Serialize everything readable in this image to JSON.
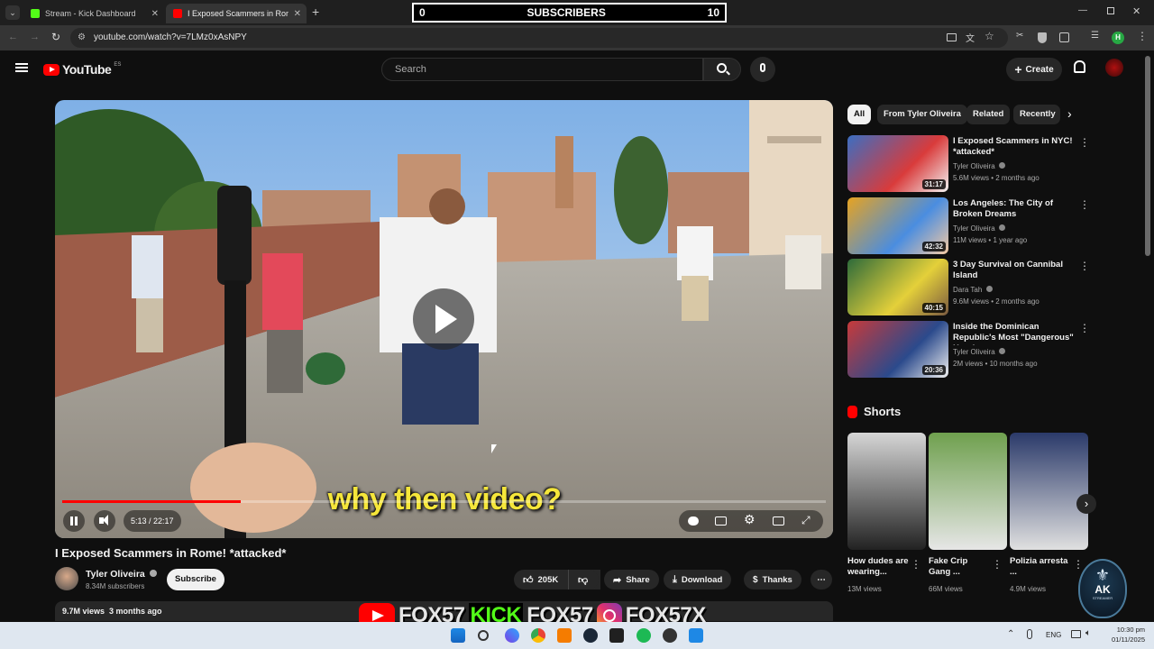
{
  "browser": {
    "tabs": [
      {
        "label": "Stream - Kick Dashboard"
      },
      {
        "label": "I Exposed Scammers in Rome! *att"
      }
    ],
    "url": "youtube.com/watch?v=7LMz0xAsNPY"
  },
  "overlay": {
    "sub_left": "0",
    "sub_label": "SUBSCRIBERS",
    "sub_right": "10",
    "caption": "why then video?",
    "banner": [
      "FOX57",
      "FOX57",
      "FOX57X"
    ],
    "kick_word": "KICK",
    "logo_text": "AK",
    "logo_sub": "STREAMER"
  },
  "header": {
    "brand": "YouTube",
    "region": "ES",
    "search_placeholder": "Search",
    "create_label": "Create"
  },
  "player": {
    "time": "5:13 / 22:17",
    "progress": 0.234
  },
  "video": {
    "title": "I Exposed Scammers in Rome! *attacked*",
    "channel": "Tyler Oliveira",
    "subscribers": "8.34M subscribers",
    "subscribe_label": "Subscribe",
    "likes": "205K",
    "share_label": "Share",
    "download_label": "Download",
    "thanks_label": "Thanks",
    "stats": "9.7M views  3 months ago"
  },
  "chips": [
    "All",
    "From Tyler Oliveira",
    "Related",
    "Recently"
  ],
  "recommendations": [
    {
      "title": "I Exposed Scammers in NYC! *attacked*",
      "channel": "Tyler Oliveira",
      "meta": "5.6M views • 2 months ago",
      "duration": "31:17"
    },
    {
      "title": "Los Angeles: The City of Broken Dreams",
      "channel": "Tyler Oliveira",
      "meta": "11M views • 1 year ago",
      "duration": "42:32"
    },
    {
      "title": "3 Day Survival on Cannibal Island",
      "channel": "Dara Tah",
      "meta": "9.6M views • 2 months ago",
      "duration": "40:15"
    },
    {
      "title": "Inside the Dominican Republic's Most \"Dangerous\" Hood",
      "channel": "Tyler Oliveira",
      "meta": "2M views • 10 months ago",
      "duration": "20:36"
    }
  ],
  "shorts": {
    "heading": "Shorts",
    "items": [
      {
        "title": "How dudes are wearing...",
        "views": "13M views"
      },
      {
        "title": "Fake Crip Gang ...",
        "views": "66M views"
      },
      {
        "title": "Polizia arresta ...",
        "views": "4.9M views"
      }
    ]
  },
  "taskbar": {
    "lang": "ENG",
    "time": "10:30 pm",
    "date": "01/11/2025"
  },
  "colors": {
    "accent": "#ff0000",
    "kick": "#53fc18",
    "caption": "#f5e63a"
  }
}
